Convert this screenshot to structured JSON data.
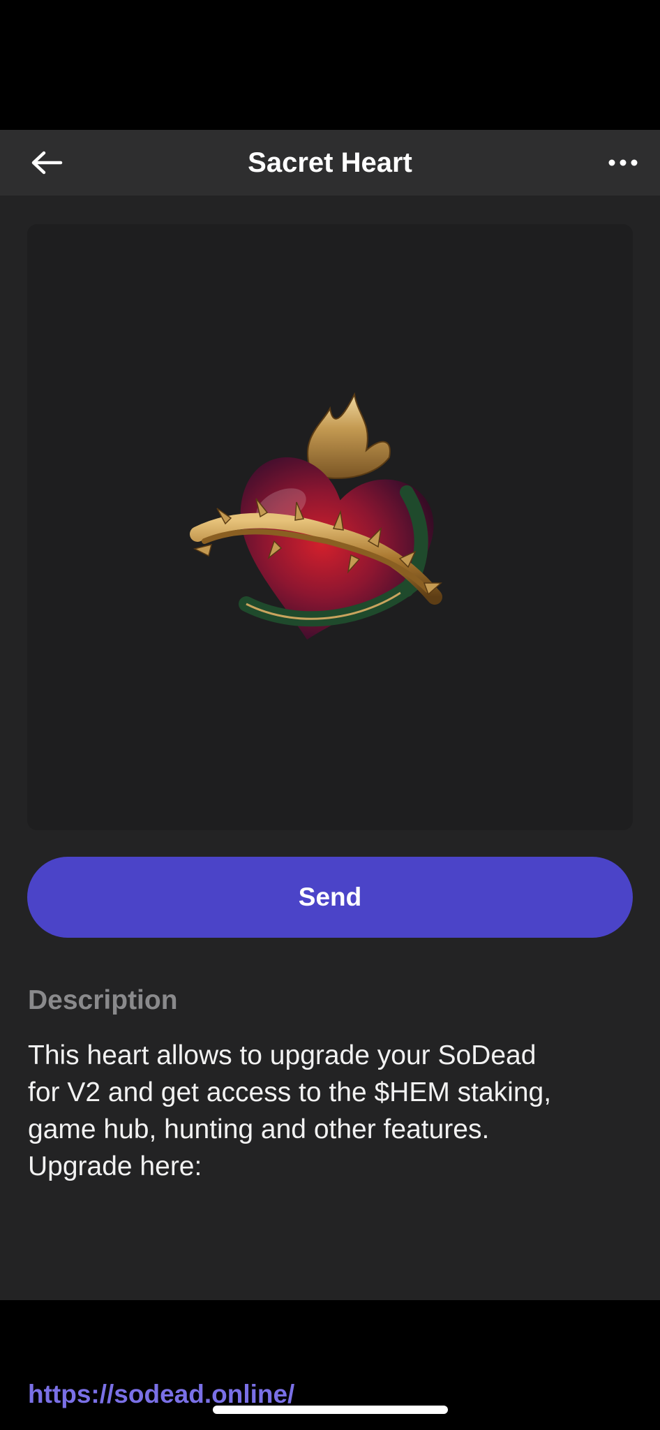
{
  "header": {
    "title": "Sacret Heart",
    "back_icon": "arrow-left-icon",
    "more_icon": "more-horizontal-icon"
  },
  "nft": {
    "image_alt": "Sacred heart with golden thorn crown"
  },
  "actions": {
    "send_label": "Send"
  },
  "description": {
    "heading": "Description",
    "text": "This heart allows to upgrade your SoDead\nfor V2 and get access to the $HEM staking,\ngame hub, hunting and other features.\nUpgrade here:",
    "link": "https://sodead.online/"
  },
  "colors": {
    "accent": "#4b44c8",
    "link": "#7a70e6",
    "background": "#232324",
    "header_bg": "#2e2e2f"
  }
}
